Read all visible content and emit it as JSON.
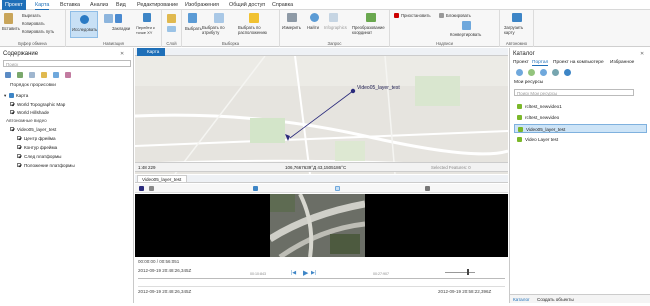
{
  "ribbon_tabs": [
    "Проект",
    "Карта",
    "Вставка",
    "Анализ",
    "Вид",
    "Редактирование",
    "Изображения",
    "Общий доступ",
    "Справка"
  ],
  "ribbon": {
    "clipboard": {
      "paste": "Вставить",
      "cut": "Вырезать",
      "copy": "Копировать",
      "copy_path": "Копировать путь",
      "group": "Буфер обмена"
    },
    "navigation": {
      "explore": "Исследовать",
      "bookmarks": "Закладки",
      "goto_xy": "Перейти к точке XY",
      "group": "Навигация"
    },
    "layer": {
      "group": "Слой"
    },
    "selection": {
      "select": "Выбрать",
      "by_attr": "Выбрать по атрибуту",
      "by_loc": "Выбрать по расположению",
      "group": "Выборка"
    },
    "inquiry": {
      "measure": "Измерить",
      "locate": "Найти",
      "infographics": "Infographics",
      "coord_conv": "Преобразование координат",
      "group": "Запрос"
    },
    "labeling": {
      "pause": "Приостановить",
      "lock": "Блокировать",
      "convert": "Конвертировать",
      "group": "Надписи"
    },
    "offline": {
      "download": "Загрузить карту",
      "group": "Автономно"
    }
  },
  "contents": {
    "title": "Содержание",
    "search_placeholder": "Поиск",
    "drawing_order": "Порядок прорисовки",
    "map": "Карта",
    "layers": [
      "World Topographic Map",
      "World Hillshade"
    ],
    "auto_video": "Автономные видео",
    "video_layer": "Video05_layer_test",
    "video_sublayers": [
      "Центр фрейма",
      "Контур фрейма",
      "След платформы",
      "Положение платформы"
    ]
  },
  "map_view": {
    "tab": "Карта",
    "label": "Video05_layer_test",
    "scale": "1:48 229",
    "coords": "106,7667639°Д 43,1505186°С",
    "selected": "Selected Features: 0"
  },
  "video_player": {
    "tab": "Video05_layer_test",
    "time_current": "00:00:00 / 00:56:051",
    "date_start": "2012-09-19 20:48:26,345Z",
    "date_end": "2012-09-19 20:58:22,396Z",
    "marks": [
      "00:10:843",
      "00:27:907"
    ]
  },
  "catalog": {
    "title": "Каталог",
    "tabs": [
      "Проект",
      "Портал",
      "Проект на компьютере",
      "Избранное"
    ],
    "my_resources": "Мои ресурсы",
    "search_placeholder": "Поиск Мои ресурсы",
    "items": [
      "rcltest_newvideo1",
      "rcltest_newvideo",
      "Video05_layer_test",
      "Video Layer test"
    ],
    "selected_index": 2,
    "bottom_tabs": [
      "Каталог",
      "Создать объекты"
    ]
  },
  "colors": {
    "accent": "#1e6fb8",
    "selection": "#cde4f7",
    "map_bg": "#e8e6e1"
  }
}
